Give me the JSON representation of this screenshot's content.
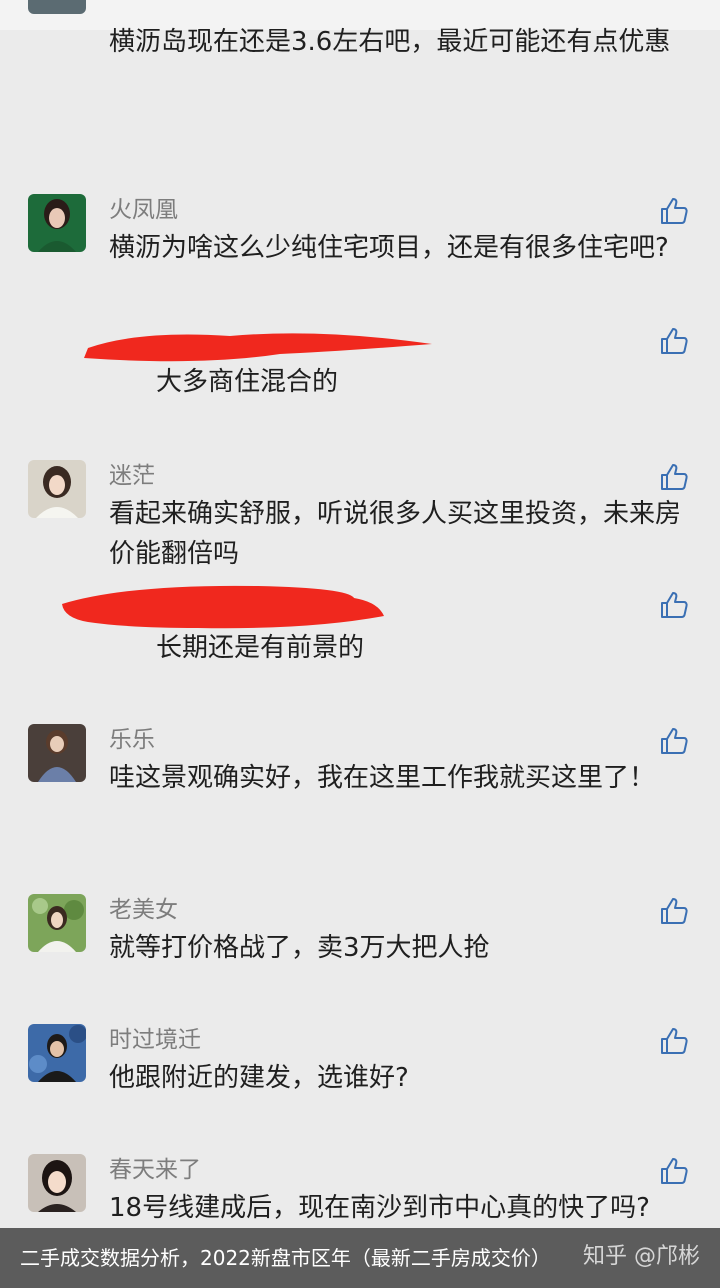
{
  "top_fragment": {
    "text": "横沥岛现在还是3.6左右吧，最近可能还有点优惠"
  },
  "comments": [
    {
      "username": "火凤凰",
      "text": "横沥为啥这么少纯住宅项目，还是有很多住宅吧?",
      "reply": "大多商住混合的"
    },
    {
      "username": "迷茫",
      "text": "看起来确实舒服，听说很多人买这里投资，未来房价能翻倍吗",
      "reply": "长期还是有前景的"
    },
    {
      "username": "乐乐",
      "text": "哇这景观确实好，我在这里工作我就买这里了！"
    },
    {
      "username": "老美女",
      "text": "就等打价格战了，卖3万大把人抢"
    },
    {
      "username": "时过境迁",
      "text": "他跟附近的建发，选谁好?"
    },
    {
      "username": "春天来了",
      "text": "18号线建成后，现在南沙到市中心真的快了吗?"
    }
  ],
  "footer": {
    "caption": "二手成交数据分析，2022新盘市区年（最新二手房成交价）",
    "watermark": "知乎 @邝彬"
  },
  "colors": {
    "background": "#ebebeb",
    "username": "#7d7d7d",
    "like_icon": "#3a6fb3",
    "redaction": "#f0281e"
  },
  "icons": {
    "like": "thumbs-up-icon"
  }
}
